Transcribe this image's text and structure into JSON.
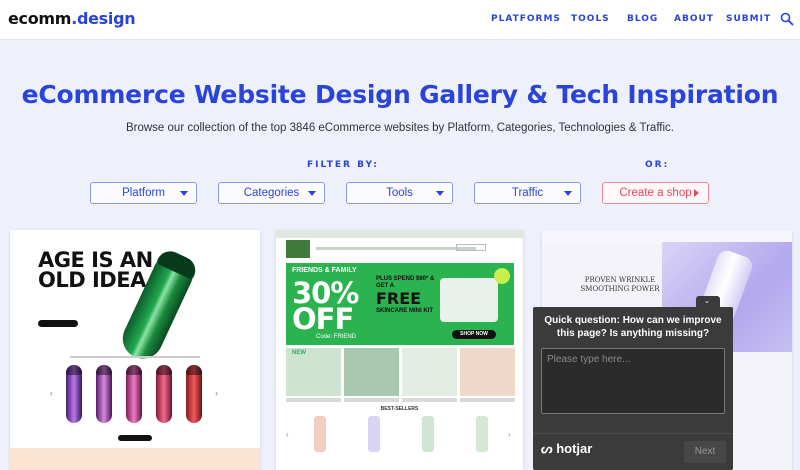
{
  "header": {
    "logo_part1": "ecomm",
    "logo_part2": ".design",
    "nav": [
      "PLATFORMS",
      "TOOLS",
      "BLOG",
      "ABOUT",
      "SUBMIT"
    ]
  },
  "hero": {
    "title": "eCommerce Website Design Gallery & Tech Inspiration",
    "subtitle": "Browse our collection of the top 3846 eCommerce websites by Platform, Categories, Technologies & Traffic.",
    "filter_label": "FILTER BY:",
    "or_label": "OR:",
    "filters": [
      "Platform",
      "Categories",
      "Tools",
      "Traffic"
    ],
    "create_shop": "Create a shop"
  },
  "cards": {
    "card1": {
      "headline_line1": "AGE IS AN",
      "headline_line2": "OLD IDEA"
    },
    "card2": {
      "friends_family": "FRIENDS & FAMILY",
      "discount_line1": "30%",
      "discount_line2": "OFF",
      "code": "Code: FRIEND",
      "plus_spend": "PLUS SPEND $60* & GET A",
      "free": "FREE",
      "skincare": "SKINCARE MINI KIT",
      "shop_now": "SHOP NOW",
      "new_badge": "NEW",
      "best_sellers": "BEST-SELLERS"
    },
    "card3": {
      "headline": "PROVEN WRINKLE SMOOTHING POWER"
    }
  },
  "hotjar": {
    "question": "Quick question: How can we improve this page? Is anything missing?",
    "placeholder": "Please type here...",
    "brand": "hotjar",
    "next_label": "Next"
  },
  "colors": {
    "brand_blue": "#2a43d9",
    "create_shop_red": "#e2485c",
    "hotjar_bg": "#3b3b3b",
    "promo_green": "#2bb34f"
  }
}
